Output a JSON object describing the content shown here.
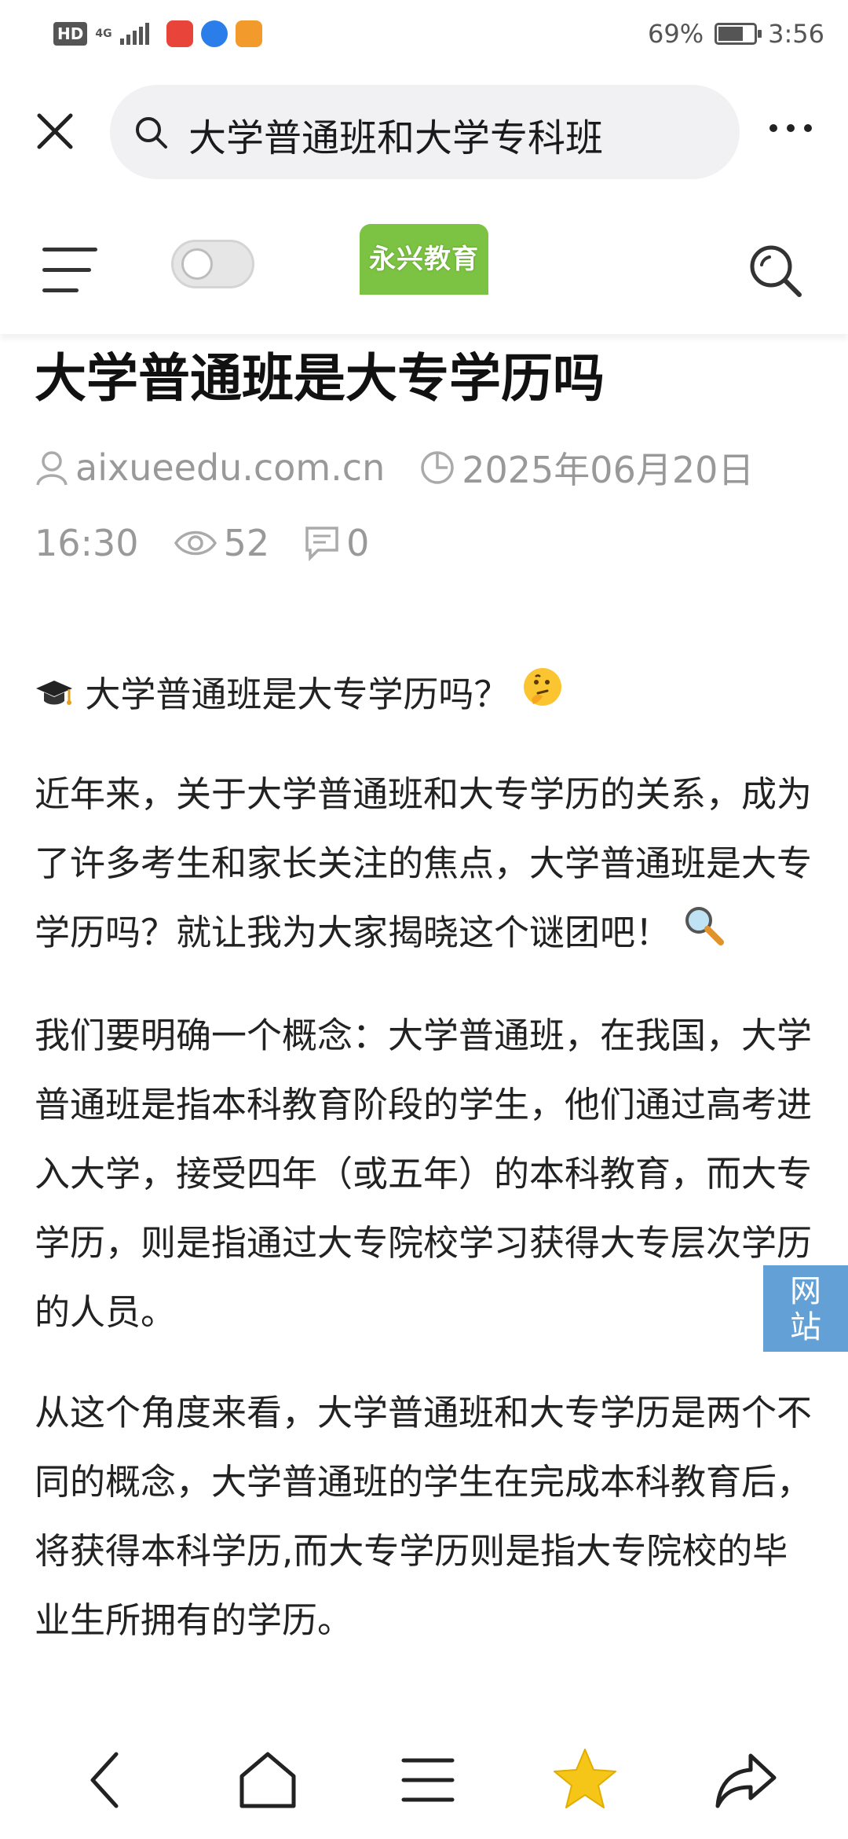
{
  "status_bar": {
    "hd": "HD",
    "network": "4G",
    "battery": "69%",
    "battery_level": 0.69,
    "time": "3:56"
  },
  "search": {
    "query": "大学普通班和大学专科班"
  },
  "site": {
    "logo_text": "永兴教育"
  },
  "article": {
    "title": "大学普通班是大专学历吗",
    "author": "aixueedu.com.cn",
    "date": "2025年06月20日",
    "time": "16:30",
    "views": "52",
    "comments": "0",
    "paragraphs": [
      "大学普通班是大专学历吗？",
      "近年来，关于大学普通班和大专学历的关系，成为了许多考生和家长关注的焦点，大学普通班是大专学历吗？就让我为大家揭晓这个谜团吧！",
      "我们要明确一个概念：大学普通班，在我国，大学普通班是指本科教育阶段的学生，他们通过高考进入大学，接受四年（或五年）的本科教育，而大专学历，则是指通过大专院校学习获得大专层次学历的人员。",
      "从这个角度来看，大学普通班和大专学历是两个不同的概念，大学普通班的学生在完成本科教育后，将获得本科学历,而大专学历则是指大专院校的毕业生所拥有的学历。"
    ]
  },
  "float_tab": {
    "label": "网站"
  },
  "icons": {
    "close": "close-icon",
    "search": "search-icon",
    "more": "more-icon",
    "menu": "menu-icon",
    "user": "user-icon",
    "clock": "clock-icon",
    "eye": "eye-icon",
    "comment": "comment-icon",
    "back": "back-icon",
    "home": "home-icon",
    "tabs": "tabs-icon",
    "star": "star-icon",
    "share": "share-icon"
  },
  "colors": {
    "logo_bg": "#7cc243",
    "float_tab_bg": "#5a9bd4",
    "star": "#f5c518",
    "meta_text": "#999999"
  }
}
